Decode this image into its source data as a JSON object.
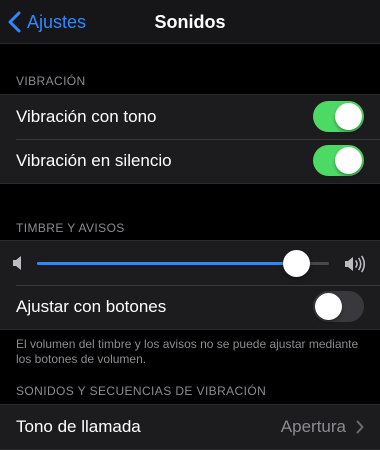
{
  "nav": {
    "back_label": "Ajustes",
    "title": "Sonidos"
  },
  "vibration_section": {
    "header": "VIBRACIÓN",
    "items": [
      {
        "label": "Vibración con tono",
        "on": true
      },
      {
        "label": "Vibración en silencio",
        "on": true
      }
    ]
  },
  "ringer_section": {
    "header": "TIMBRE Y AVISOS",
    "volume_level": 0.89,
    "adjust_with_buttons": {
      "label": "Ajustar con botones",
      "on": false
    },
    "footnote": "El volumen del timbre y los avisos no se puede ajustar mediante los botones de volumen."
  },
  "sounds_section": {
    "header": "SONIDOS Y SECUENCIAS DE VIBRACIÓN",
    "ringtone": {
      "label": "Tono de llamada",
      "value": "Apertura"
    }
  },
  "colors": {
    "accent": "#2f88ff",
    "toggle_on": "#4cd964",
    "toggle_off": "#39393d"
  },
  "icons": {
    "back": "chevron-left-icon",
    "volume_low": "speaker-icon",
    "volume_high": "speaker-wave-icon",
    "disclosure": "chevron-right-icon"
  }
}
